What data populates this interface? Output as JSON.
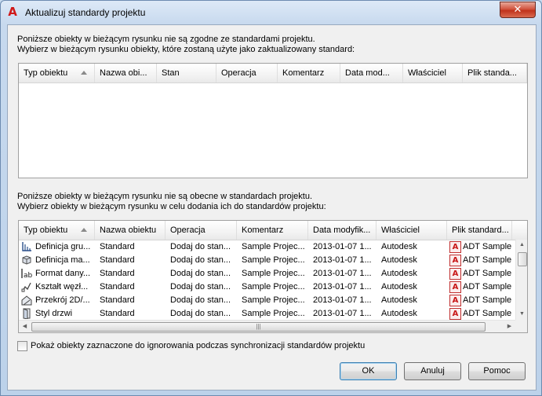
{
  "window": {
    "title": "Aktualizuj standardy projektu",
    "close_glyph": "✕"
  },
  "section1": {
    "line1": "Poniższe obiekty w bieżącym rysunku nie są zgodne ze standardami projektu.",
    "line2": "Wybierz w bieżącym rysunku obiekty, które zostaną użyte jako zaktualizowany standard:",
    "columns": [
      "Typ obiektu",
      "Nazwa obi...",
      "Stan",
      "Operacja",
      "Komentarz",
      "Data mod...",
      "Właściciel",
      "Plik standa..."
    ]
  },
  "section2": {
    "line1": "Poniższe obiekty w bieżącym rysunku nie są obecne w standardach projektu.",
    "line2": "Wybierz obiekty w bieżącym rysunku w celu dodania ich do standardów projektu:",
    "columns": [
      "Typ obiektu",
      "Nazwa obiektu",
      "Operacja",
      "Komentarz",
      "Data modyfik...",
      "Właściciel",
      "Plik standard..."
    ],
    "rows": [
      {
        "type": "Definicja gru...",
        "icon": "grid-definition-icon",
        "name": "Standard",
        "operation": "Dodaj do stan...",
        "comment": "Sample Projec...",
        "date": "2013-01-07 1...",
        "owner": "Autodesk",
        "file": "ADT Sample"
      },
      {
        "type": "Definicja ma...",
        "icon": "material-definition-icon",
        "name": "Standard",
        "operation": "Dodaj do stan...",
        "comment": "Sample Projec...",
        "date": "2013-01-07 1...",
        "owner": "Autodesk",
        "file": "ADT Sample"
      },
      {
        "type": "Format dany...",
        "icon": "data-format-icon",
        "name": "Standard",
        "operation": "Dodaj do stan...",
        "comment": "Sample Projec...",
        "date": "2013-01-07 1...",
        "owner": "Autodesk",
        "file": "ADT Sample"
      },
      {
        "type": "Kształt węzł...",
        "icon": "node-shape-icon",
        "name": "Standard",
        "operation": "Dodaj do stan...",
        "comment": "Sample Projec...",
        "date": "2013-01-07 1...",
        "owner": "Autodesk",
        "file": "ADT Sample"
      },
      {
        "type": "Przekrój 2D/...",
        "icon": "section-2d-icon",
        "name": "Standard",
        "operation": "Dodaj do stan...",
        "comment": "Sample Projec...",
        "date": "2013-01-07 1...",
        "owner": "Autodesk",
        "file": "ADT Sample"
      },
      {
        "type": "Styl drzwi",
        "icon": "door-style-icon",
        "name": "Standard",
        "operation": "Dodaj do stan...",
        "comment": "Sample Projec...",
        "date": "2013-01-07 1...",
        "owner": "Autodesk",
        "file": "ADT Sample"
      }
    ]
  },
  "checkbox": {
    "label": "Pokaż obiekty zaznaczone do ignorowania podczas synchronizacji standardów projektu",
    "checked": false
  },
  "buttons": {
    "ok": "OK",
    "cancel": "Anuluj",
    "help": "Pomoc"
  },
  "colors": {
    "accent_red": "#c81818",
    "window_frame": "#6d8bb0",
    "client_bg": "#f0f0f0"
  }
}
